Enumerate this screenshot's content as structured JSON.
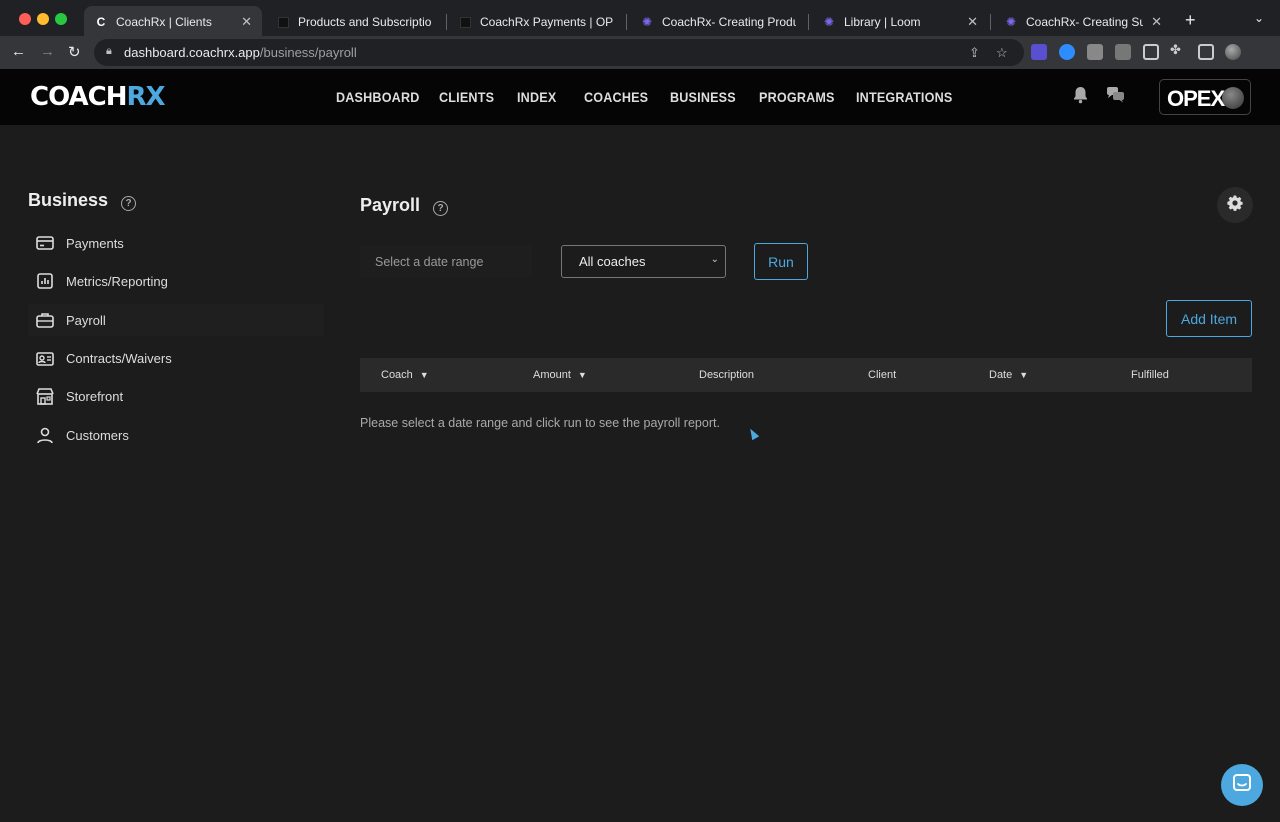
{
  "browser": {
    "tabs": [
      {
        "title": "CoachRx | Clients",
        "icon": "coachrx-favicon",
        "active": true
      },
      {
        "title": "Products and Subscriptio",
        "icon": "page-favicon",
        "active": false
      },
      {
        "title": "CoachRx Payments | OPE",
        "icon": "page-favicon",
        "active": false
      },
      {
        "title": "CoachRx- Creating Produ",
        "icon": "loom-favicon",
        "active": false
      },
      {
        "title": "Library | Loom",
        "icon": "loom-favicon",
        "active": false
      },
      {
        "title": "CoachRx- Creating Subsc",
        "icon": "loom-favicon",
        "active": false
      }
    ],
    "url_host": "dashboard.coachrx.app",
    "url_path": "/business/payroll"
  },
  "header": {
    "logo_main": "COACH",
    "logo_accent": "RX",
    "nav": [
      "DASHBOARD",
      "CLIENTS",
      "INDEX",
      "COACHES",
      "BUSINESS",
      "PROGRAMS",
      "INTEGRATIONS"
    ],
    "brand_badge": "OPEX"
  },
  "sidebar": {
    "title": "Business",
    "items": [
      {
        "label": "Payments",
        "icon": "credit-card-icon"
      },
      {
        "label": "Metrics/Reporting",
        "icon": "bar-chart-icon"
      },
      {
        "label": "Payroll",
        "icon": "briefcase-icon",
        "active": true
      },
      {
        "label": "Contracts/Waivers",
        "icon": "id-card-icon"
      },
      {
        "label": "Storefront",
        "icon": "storefront-icon"
      },
      {
        "label": "Customers",
        "icon": "users-icon"
      }
    ]
  },
  "main": {
    "title": "Payroll",
    "date_placeholder": "Select a date range",
    "coach_select": "All coaches",
    "run_label": "Run",
    "add_item_label": "Add Item",
    "columns": [
      "Coach",
      "Amount",
      "Description",
      "Client",
      "Date",
      "Fulfilled"
    ],
    "empty_message": "Please select a date range and click run to see the payroll report."
  },
  "colors": {
    "accent": "#4da8e0",
    "background": "#1c1c1c",
    "header": "#050505"
  }
}
